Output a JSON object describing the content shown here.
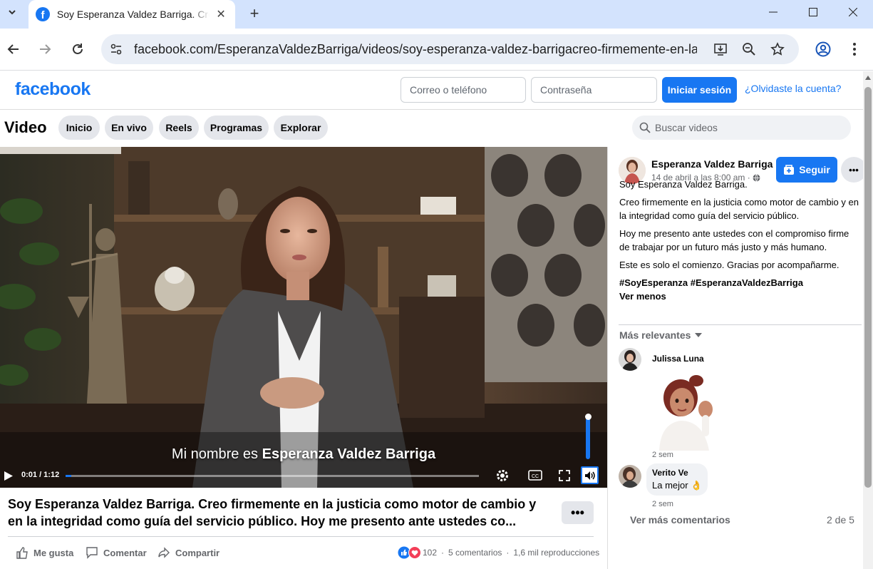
{
  "browser": {
    "tab_title": "Soy Esperanza Valdez Barriga. Cre",
    "url": "facebook.com/EsperanzaValdezBarriga/videos/soy-esperanza-valdez-barrigacreo-firmemente-en-la-j..."
  },
  "header": {
    "logo": "facebook",
    "email_placeholder": "Correo o teléfono",
    "password_placeholder": "Contraseña",
    "login_label": "Iniciar sesión",
    "forgot_label": "¿Olvidaste la cuenta?"
  },
  "video_nav": {
    "title": "Video",
    "chips": [
      "Inicio",
      "En vivo",
      "Reels",
      "Programas",
      "Explorar"
    ],
    "search_placeholder": "Buscar videos"
  },
  "player": {
    "subtitle_prefix": "Mi nombre es ",
    "subtitle_name": "Esperanza Valdez Barriga",
    "time": "0:01 / 1:12",
    "progress": 0.014
  },
  "post": {
    "caption": "Soy Esperanza Valdez Barriga. Creo firmemente en la justicia como motor de cambio y en la integridad como guía del servicio público. Hoy me presento ante ustedes co...",
    "actions": {
      "like": "Me gusta",
      "comment": "Comentar",
      "share": "Compartir"
    },
    "reactions": "102",
    "comments_count": "5 comentarios",
    "views": "1,6 mil reproducciones"
  },
  "author": {
    "name": "Esperanza Valdez Barriga",
    "date": "14 de abril a las 8:00 am ·",
    "follow_label": "Seguir",
    "paragraphs": [
      "Soy Esperanza Valdez Barriga.",
      "Creo firmemente en la justicia como motor de cambio y en la integridad como guía del servicio público.",
      "Hoy me presento ante ustedes con el compromiso firme de trabajar por un futuro más justo y más humano.",
      "Este es solo el comienzo. Gracias por acompañarme."
    ],
    "hashtags": "#SoyEsperanza #EsperanzaValdezBarriga",
    "see_less": "Ver menos"
  },
  "comments": {
    "sort_label": "Más relevantes",
    "items": [
      {
        "name": "Julissa Luna",
        "text": "",
        "time": "2 sem"
      },
      {
        "name": "Verito Ve",
        "text": "La mejor 👌",
        "time": "2 sem"
      }
    ],
    "more_label": "Ver más comentarios",
    "pagination": "2 de 5"
  }
}
